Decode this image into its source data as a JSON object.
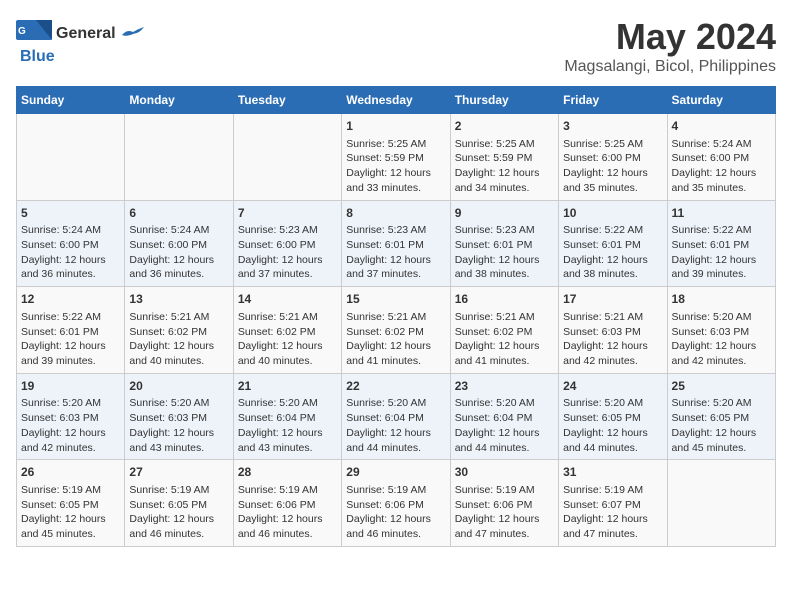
{
  "logo": {
    "general": "General",
    "blue": "Blue"
  },
  "title": "May 2024",
  "subtitle": "Magsalangi, Bicol, Philippines",
  "days": [
    "Sunday",
    "Monday",
    "Tuesday",
    "Wednesday",
    "Thursday",
    "Friday",
    "Saturday"
  ],
  "weeks": [
    [
      {
        "day": "",
        "info": ""
      },
      {
        "day": "",
        "info": ""
      },
      {
        "day": "",
        "info": ""
      },
      {
        "day": "1",
        "info": "Sunrise: 5:25 AM\nSunset: 5:59 PM\nDaylight: 12 hours and 33 minutes."
      },
      {
        "day": "2",
        "info": "Sunrise: 5:25 AM\nSunset: 5:59 PM\nDaylight: 12 hours and 34 minutes."
      },
      {
        "day": "3",
        "info": "Sunrise: 5:25 AM\nSunset: 6:00 PM\nDaylight: 12 hours and 35 minutes."
      },
      {
        "day": "4",
        "info": "Sunrise: 5:24 AM\nSunset: 6:00 PM\nDaylight: 12 hours and 35 minutes."
      }
    ],
    [
      {
        "day": "5",
        "info": "Sunrise: 5:24 AM\nSunset: 6:00 PM\nDaylight: 12 hours and 36 minutes."
      },
      {
        "day": "6",
        "info": "Sunrise: 5:24 AM\nSunset: 6:00 PM\nDaylight: 12 hours and 36 minutes."
      },
      {
        "day": "7",
        "info": "Sunrise: 5:23 AM\nSunset: 6:00 PM\nDaylight: 12 hours and 37 minutes."
      },
      {
        "day": "8",
        "info": "Sunrise: 5:23 AM\nSunset: 6:01 PM\nDaylight: 12 hours and 37 minutes."
      },
      {
        "day": "9",
        "info": "Sunrise: 5:23 AM\nSunset: 6:01 PM\nDaylight: 12 hours and 38 minutes."
      },
      {
        "day": "10",
        "info": "Sunrise: 5:22 AM\nSunset: 6:01 PM\nDaylight: 12 hours and 38 minutes."
      },
      {
        "day": "11",
        "info": "Sunrise: 5:22 AM\nSunset: 6:01 PM\nDaylight: 12 hours and 39 minutes."
      }
    ],
    [
      {
        "day": "12",
        "info": "Sunrise: 5:22 AM\nSunset: 6:01 PM\nDaylight: 12 hours and 39 minutes."
      },
      {
        "day": "13",
        "info": "Sunrise: 5:21 AM\nSunset: 6:02 PM\nDaylight: 12 hours and 40 minutes."
      },
      {
        "day": "14",
        "info": "Sunrise: 5:21 AM\nSunset: 6:02 PM\nDaylight: 12 hours and 40 minutes."
      },
      {
        "day": "15",
        "info": "Sunrise: 5:21 AM\nSunset: 6:02 PM\nDaylight: 12 hours and 41 minutes."
      },
      {
        "day": "16",
        "info": "Sunrise: 5:21 AM\nSunset: 6:02 PM\nDaylight: 12 hours and 41 minutes."
      },
      {
        "day": "17",
        "info": "Sunrise: 5:21 AM\nSunset: 6:03 PM\nDaylight: 12 hours and 42 minutes."
      },
      {
        "day": "18",
        "info": "Sunrise: 5:20 AM\nSunset: 6:03 PM\nDaylight: 12 hours and 42 minutes."
      }
    ],
    [
      {
        "day": "19",
        "info": "Sunrise: 5:20 AM\nSunset: 6:03 PM\nDaylight: 12 hours and 42 minutes."
      },
      {
        "day": "20",
        "info": "Sunrise: 5:20 AM\nSunset: 6:03 PM\nDaylight: 12 hours and 43 minutes."
      },
      {
        "day": "21",
        "info": "Sunrise: 5:20 AM\nSunset: 6:04 PM\nDaylight: 12 hours and 43 minutes."
      },
      {
        "day": "22",
        "info": "Sunrise: 5:20 AM\nSunset: 6:04 PM\nDaylight: 12 hours and 44 minutes."
      },
      {
        "day": "23",
        "info": "Sunrise: 5:20 AM\nSunset: 6:04 PM\nDaylight: 12 hours and 44 minutes."
      },
      {
        "day": "24",
        "info": "Sunrise: 5:20 AM\nSunset: 6:05 PM\nDaylight: 12 hours and 44 minutes."
      },
      {
        "day": "25",
        "info": "Sunrise: 5:20 AM\nSunset: 6:05 PM\nDaylight: 12 hours and 45 minutes."
      }
    ],
    [
      {
        "day": "26",
        "info": "Sunrise: 5:19 AM\nSunset: 6:05 PM\nDaylight: 12 hours and 45 minutes."
      },
      {
        "day": "27",
        "info": "Sunrise: 5:19 AM\nSunset: 6:05 PM\nDaylight: 12 hours and 46 minutes."
      },
      {
        "day": "28",
        "info": "Sunrise: 5:19 AM\nSunset: 6:06 PM\nDaylight: 12 hours and 46 minutes."
      },
      {
        "day": "29",
        "info": "Sunrise: 5:19 AM\nSunset: 6:06 PM\nDaylight: 12 hours and 46 minutes."
      },
      {
        "day": "30",
        "info": "Sunrise: 5:19 AM\nSunset: 6:06 PM\nDaylight: 12 hours and 47 minutes."
      },
      {
        "day": "31",
        "info": "Sunrise: 5:19 AM\nSunset: 6:07 PM\nDaylight: 12 hours and 47 minutes."
      },
      {
        "day": "",
        "info": ""
      }
    ]
  ]
}
